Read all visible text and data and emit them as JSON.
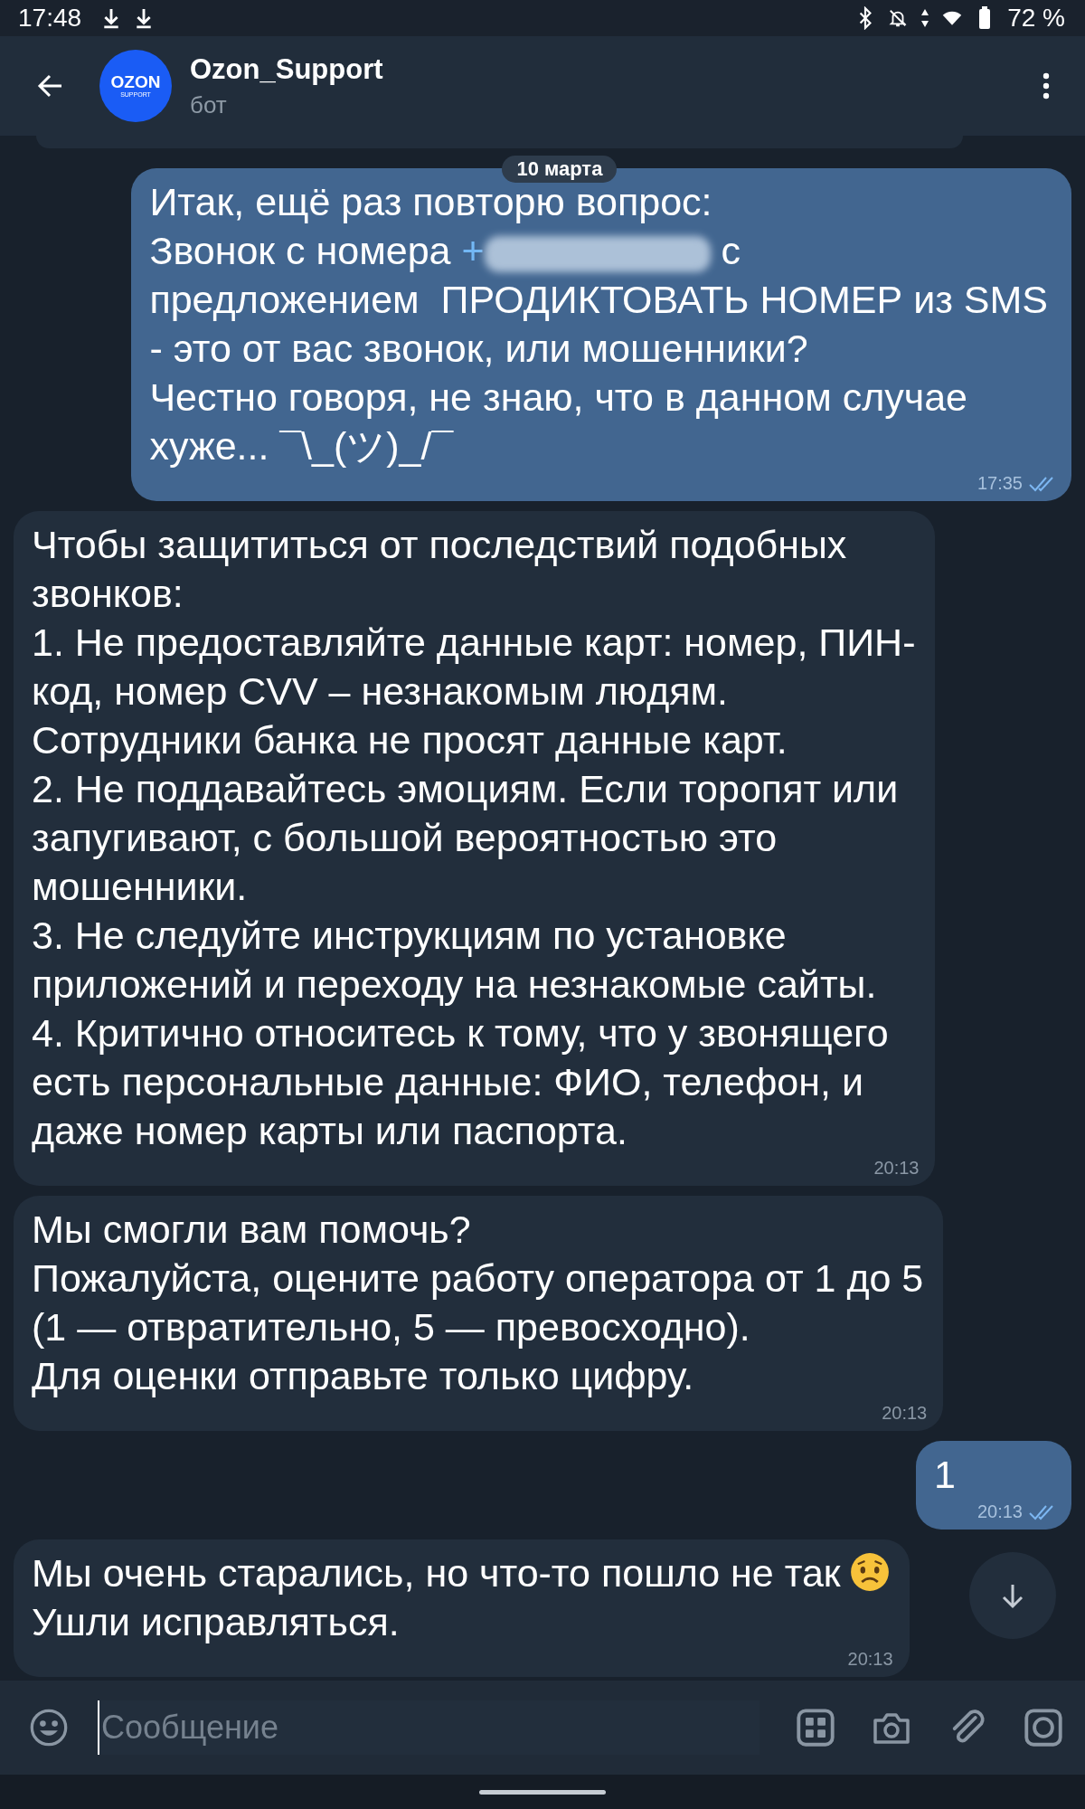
{
  "status_bar": {
    "time": "17:48",
    "battery": "72 %"
  },
  "header": {
    "title": "Ozon_Support",
    "subtitle": "бот",
    "avatar": {
      "line1": "OZON",
      "line2": "SUPPORT"
    }
  },
  "date_badge": "10 марта",
  "messages": [
    {
      "out": true,
      "time": "17:35",
      "read": true,
      "paragraphs": [
        {
          "text": "Итак, ещё раз повторю вопрос:\nЗвонок с номера ",
          "link": "+",
          "redacted": true,
          "after": " с\nпредложением  ПРОДИКТОВАТЬ НОМЕР из SMS\n- это от вас звонок, или мошенники?\nЧестно говоря, не знаю, что в данном случае\nхуже... ¯\\_(ツ)_/¯",
          "emoji": false
        }
      ]
    },
    {
      "out": false,
      "time": "20:13",
      "read": false,
      "paragraphs": [
        {
          "text": "Чтобы защититься от последствий подобных\nзвонков:\n1. Не предоставляйте данные карт: номер, ПИН-\nкод, номер CVV – незнакомым людям.\nСотрудники банка не просят данные карт.\n2. Не поддавайтесь эмоциям. Если торопят или\nзапугивают, с большой вероятностью это\nмошенники.\n3. Не следуйте инструкциям по установке\nприложений и переходу на незнакомые сайты.\n4. Критично относитесь к тому, что у звонящего\nесть персональные данные: ФИО, телефон, и\nдаже номер карты или паспорта.",
          "emoji": false
        }
      ]
    },
    {
      "out": false,
      "time": "20:13",
      "read": false,
      "paragraphs": [
        {
          "text": "Мы смогли вам помочь?\nПожалуйста, оцените работу оператора от 1 до 5\n(1 — отвратительно, 5 — превосходно).\nДля оценки отправьте только цифру.",
          "emoji": false
        }
      ]
    },
    {
      "out": true,
      "time": "20:13",
      "read": true,
      "paragraphs": [
        {
          "text": "1",
          "emoji": false
        }
      ]
    },
    {
      "out": false,
      "time": "20:13",
      "read": false,
      "paragraphs": [
        {
          "text": "Мы очень старались, но что-то пошло не так",
          "emoji": true
        },
        {
          "text": "Ушли исправляться.",
          "emoji": false
        }
      ]
    }
  ],
  "composer": {
    "placeholder": "Сообщение"
  }
}
